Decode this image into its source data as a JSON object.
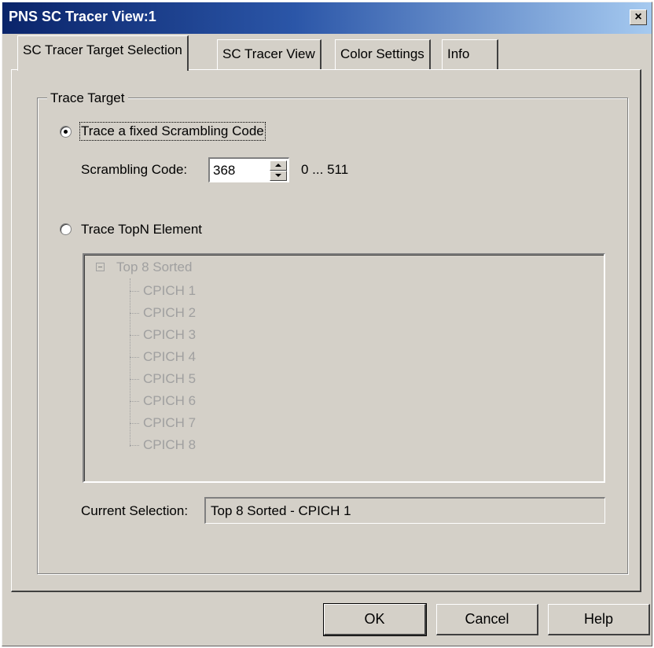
{
  "window": {
    "title": "PNS SC Tracer View:1",
    "close_label": "×"
  },
  "tabs": [
    {
      "label": "SC Tracer Target Selection",
      "active": true
    },
    {
      "label": "SC Tracer View",
      "active": false
    },
    {
      "label": "Color Settings",
      "active": false
    },
    {
      "label": "Info",
      "active": false
    }
  ],
  "trace_target": {
    "group_label": "Trace Target",
    "fixed_option": {
      "label": "Trace a fixed Scrambling Code",
      "selected": true
    },
    "scrambling_code": {
      "label": "Scrambling Code:",
      "value": "368",
      "range": "0 ... 511"
    },
    "topn_option": {
      "label": "Trace TopN Element",
      "selected": false
    },
    "tree": {
      "root": "Top 8 Sorted",
      "children": [
        "CPICH 1",
        "CPICH 2",
        "CPICH 3",
        "CPICH 4",
        "CPICH 5",
        "CPICH 6",
        "CPICH 7",
        "CPICH 8"
      ],
      "enabled": false
    },
    "current_selection": {
      "label": "Current Selection:",
      "value": "Top 8 Sorted - CPICH 1"
    }
  },
  "buttons": {
    "ok": "OK",
    "cancel": "Cancel",
    "help": "Help"
  },
  "colors": {
    "title_bar": "#0a246a",
    "dialog_bg": "#d4d0c8",
    "disabled_text": "#a0a0a0"
  }
}
